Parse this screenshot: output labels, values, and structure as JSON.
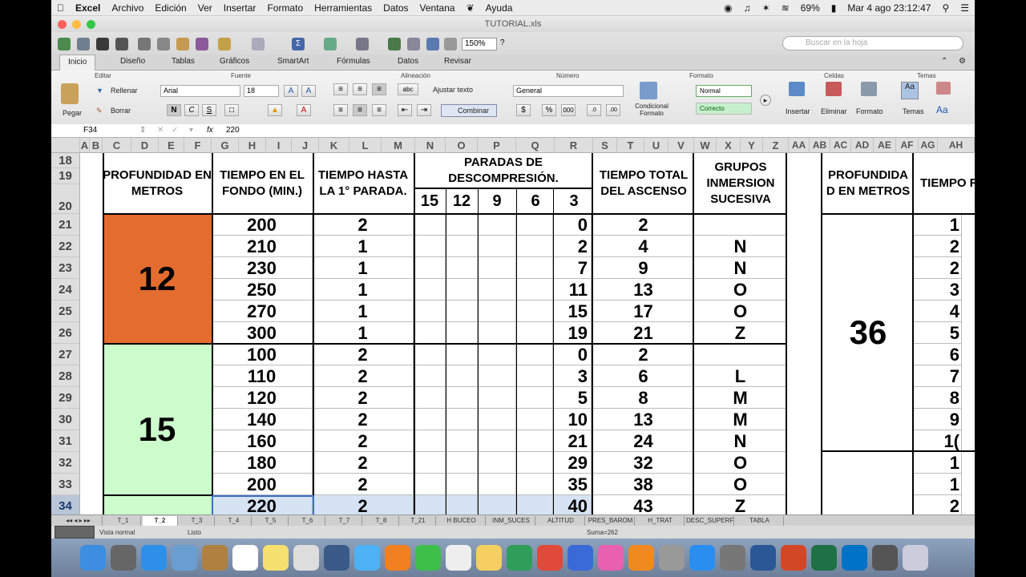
{
  "menubar": {
    "apple": "",
    "app": "Excel",
    "items": [
      "Archivo",
      "Edición",
      "Ver",
      "Insertar",
      "Formato",
      "Herramientas",
      "Datos",
      "Ventana",
      "Ayuda"
    ],
    "battery": "69%",
    "datetime": "Mar 4 ago  23:12:47"
  },
  "window": {
    "title": "TUTORIAL.xls"
  },
  "toolbar": {
    "zoom": "150%",
    "search_placeholder": "Buscar en la hoja"
  },
  "ribbon_tabs": [
    "Inicio",
    "Diseño",
    "Tablas",
    "Gráficos",
    "SmartArt",
    "Fórmulas",
    "Datos",
    "Revisar"
  ],
  "ribbon": {
    "groups": [
      "Editar",
      "Fuente",
      "Alineación",
      "Número",
      "Formato",
      "Celdas",
      "Temas"
    ],
    "paste": "Pegar",
    "fill": "Rellenar",
    "clear": "Borrar",
    "font": "Arial",
    "font_size": "18",
    "bold": "N",
    "italic": "C",
    "underline": "S",
    "wrap": "Ajustar texto",
    "merge": "Combinar",
    "number_format": "General",
    "conditional": "Condicional Formato",
    "style_normal": "Normal",
    "style_correcto": "Correcto",
    "insert": "Insertar",
    "delete": "Eliminar",
    "format": "Formato",
    "themes": "Temas"
  },
  "formula_bar": {
    "cell_ref": "F34",
    "fx": "fx",
    "value": "220"
  },
  "columns": [
    "A",
    "B",
    "C",
    "D",
    "E",
    "F",
    "G",
    "H",
    "I",
    "J",
    "K",
    "L",
    "M",
    "N",
    "O",
    "P",
    "Q",
    "R",
    "S",
    "T",
    "U",
    "V",
    "W",
    "X",
    "Y",
    "Z",
    "AA",
    "AB",
    "AC",
    "AD",
    "AE",
    "AF",
    "AG",
    "AH"
  ],
  "headers": {
    "profundidad": "PROFUNDIDAD EN METROS",
    "tiempo_fondo": "TIEMPO EN EL FONDO (MIN.)",
    "tiempo_parada": "TIEMPO HASTA LA 1° PARADA.",
    "paradas": "PARADAS DE DESCOMPRESIÓN.",
    "stops": [
      "15",
      "12",
      "9",
      "6",
      "3"
    ],
    "tiempo_total": "TIEMPO TOTAL DEL ASCENSO",
    "grupos": "GRUPOS INMERSION SUCESIVA",
    "profundidad2": "PROFUNDIDA D EN METROS",
    "tiempo2": "TIEMPO FONDO"
  },
  "depth_12": "12",
  "depth_15": "15",
  "depth_36": "36",
  "rows": [
    {
      "n": "18"
    },
    {
      "n": "19"
    },
    {
      "n": "20"
    },
    {
      "n": "21",
      "fondo": "200",
      "parada": "2",
      "s3": "0",
      "total": "2",
      "grupo": "",
      "r": "1"
    },
    {
      "n": "22",
      "fondo": "210",
      "parada": "1",
      "s3": "2",
      "total": "4",
      "grupo": "N",
      "r": "2"
    },
    {
      "n": "23",
      "fondo": "230",
      "parada": "1",
      "s3": "7",
      "total": "9",
      "grupo": "N",
      "r": "2"
    },
    {
      "n": "24",
      "fondo": "250",
      "parada": "1",
      "s3": "11",
      "total": "13",
      "grupo": "O",
      "r": "3"
    },
    {
      "n": "25",
      "fondo": "270",
      "parada": "1",
      "s3": "15",
      "total": "17",
      "grupo": "O",
      "r": "4"
    },
    {
      "n": "26",
      "fondo": "300",
      "parada": "1",
      "s3": "19",
      "total": "21",
      "grupo": "Z",
      "r": "5"
    },
    {
      "n": "27",
      "fondo": "100",
      "parada": "2",
      "s3": "0",
      "total": "2",
      "grupo": "",
      "r": "6"
    },
    {
      "n": "28",
      "fondo": "110",
      "parada": "2",
      "s3": "3",
      "total": "6",
      "grupo": "L",
      "r": "7"
    },
    {
      "n": "29",
      "fondo": "120",
      "parada": "2",
      "s3": "5",
      "total": "8",
      "grupo": "M",
      "r": "8"
    },
    {
      "n": "30",
      "fondo": "140",
      "parada": "2",
      "s3": "10",
      "total": "13",
      "grupo": "M",
      "r": "9"
    },
    {
      "n": "31",
      "fondo": "160",
      "parada": "2",
      "s3": "21",
      "total": "24",
      "grupo": "N",
      "r": "1("
    },
    {
      "n": "32",
      "fondo": "180",
      "parada": "2",
      "s3": "29",
      "total": "32",
      "grupo": "O",
      "r": "1"
    },
    {
      "n": "33",
      "fondo": "200",
      "parada": "2",
      "s3": "35",
      "total": "38",
      "grupo": "O",
      "r": "1"
    },
    {
      "n": "34",
      "fondo": "220",
      "parada": "2",
      "s3": "40",
      "total": "43",
      "grupo": "Z",
      "r": "2"
    }
  ],
  "sheet_tabs": [
    "T_1",
    "T_2",
    "T_3",
    "T_4",
    "T_5",
    "T_6",
    "T_7",
    "T_8",
    "T_21",
    "H BUCEO",
    "INM_SUCES",
    "ALTITUD",
    "PRES_BAROM",
    "H_TRAT",
    "DESC_SUPERF",
    "TABLA"
  ],
  "status": {
    "view": "Vista normal",
    "ready": "Listo",
    "sum": "Suma=262"
  }
}
